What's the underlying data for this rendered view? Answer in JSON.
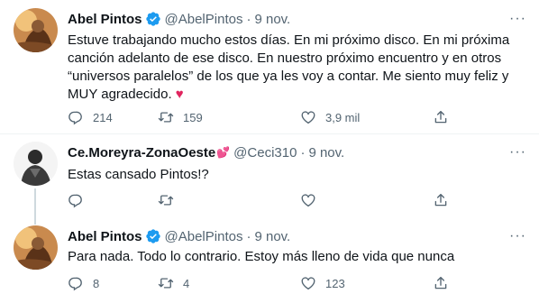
{
  "tweets": [
    {
      "name": "Abel Pintos",
      "handle": "@AbelPintos",
      "time": "9 nov.",
      "lines": [
        "Estuve trabajando mucho estos días. En mi próximo disco. En mi próxima",
        "canción adelanto de ese disco. En nuestro próximo encuentro y en otros",
        "“universos paralelos” de los que ya les voy a contar. Me siento muy feliz y",
        "MUY agradecido. "
      ],
      "emoji": "♥",
      "replies": "214",
      "retweets": "159",
      "likes": "3,9 mil",
      "more": "···"
    },
    {
      "name": "Ce.Moreyra-ZonaOeste",
      "name_emoji": "💕",
      "handle": "@Ceci310",
      "time": "9 nov.",
      "text": "Estas cansado Pintos!?",
      "replies": "",
      "retweets": "",
      "likes": "",
      "more": "···"
    },
    {
      "name": "Abel Pintos",
      "handle": "@AbelPintos",
      "time": "9 nov.",
      "text": "Para nada. Todo lo contrario. Estoy más lleno de vida que nunca",
      "replies": "8",
      "retweets": "4",
      "likes": "123",
      "more": "···"
    }
  ],
  "separator": "·",
  "colors": {
    "verified": "#1d9bf0",
    "heart": "#e0245e",
    "secondary_text": "#536471",
    "thread_line": "#cfd9de"
  },
  "icons": [
    "verified-badge-icon",
    "more-icon",
    "reply-icon",
    "retweet-icon",
    "like-icon",
    "share-icon"
  ]
}
